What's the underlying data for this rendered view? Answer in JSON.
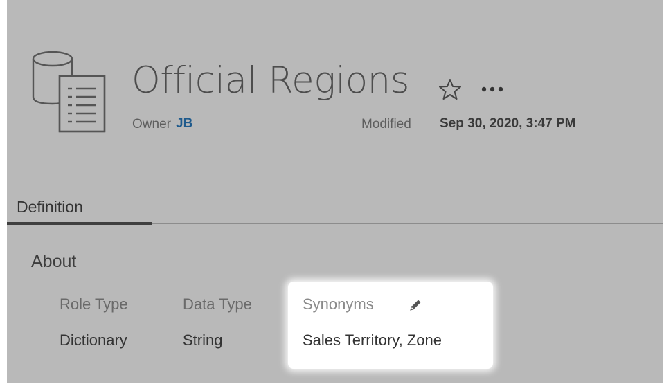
{
  "header": {
    "title": "Official Regions",
    "owner_label": "Owner",
    "owner_value": "JB",
    "modified_label": "Modified",
    "modified_value": "Sep 30, 2020, 3:47 PM",
    "icons": [
      "datasource-icon",
      "star-icon",
      "more-icon"
    ]
  },
  "tabs": [
    {
      "label": "Definition",
      "active": true
    }
  ],
  "about": {
    "heading": "About",
    "columns": [
      {
        "label": "Role Type",
        "value": "Dictionary"
      },
      {
        "label": "Data Type",
        "value": "String"
      },
      {
        "label": "Synonyms",
        "value": "Sales Territory, Zone",
        "editable": true,
        "icon": "pencil-icon"
      }
    ]
  },
  "colors": {
    "background": "#b9b9b9",
    "highlight": "#ffffff",
    "owner_link": "#1e5a8c",
    "title_text": "#4d4d4d"
  }
}
